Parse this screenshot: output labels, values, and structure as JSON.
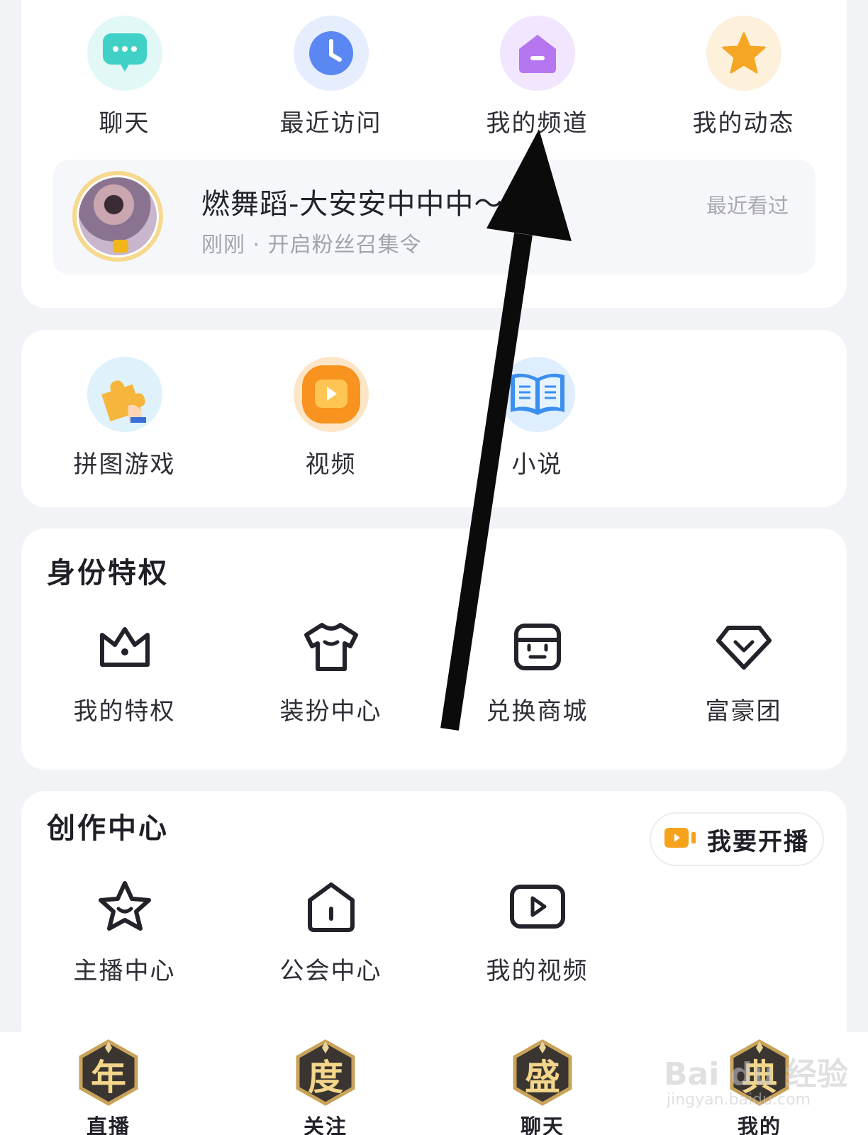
{
  "quick_actions": [
    {
      "label": "聊天",
      "icon": "chat-bubble-icon",
      "color": "#3fd1c6"
    },
    {
      "label": "最近访问",
      "icon": "clock-icon",
      "color": "#5b87f2"
    },
    {
      "label": "我的频道",
      "icon": "channel-house-icon",
      "color": "#b576f0"
    },
    {
      "label": "我的动态",
      "icon": "star-icon",
      "color": "#f5a623"
    }
  ],
  "recent": {
    "name": "燃舞蹈-大安安中中中～",
    "subtitle": "刚刚 · 开启粉丝召集令",
    "hint": "最近看过"
  },
  "apps": [
    {
      "label": "拼图游戏",
      "icon": "puzzle-icon"
    },
    {
      "label": "视频",
      "icon": "video-play-icon"
    },
    {
      "label": "小说",
      "icon": "book-icon"
    }
  ],
  "privilege": {
    "title": "身份特权",
    "items": [
      {
        "label": "我的特权",
        "icon": "crown-icon"
      },
      {
        "label": "装扮中心",
        "icon": "tshirt-icon"
      },
      {
        "label": "兑换商城",
        "icon": "store-icon"
      },
      {
        "label": "富豪团",
        "icon": "diamond-icon"
      }
    ]
  },
  "creator": {
    "title": "创作中心",
    "live_button": "我要开播",
    "items": [
      {
        "label": "主播中心",
        "icon": "star-smile-icon"
      },
      {
        "label": "公会中心",
        "icon": "guild-house-icon"
      },
      {
        "label": "我的视频",
        "icon": "video-frame-icon"
      }
    ]
  },
  "bottom_nav": [
    {
      "badge": "年",
      "label": "直播"
    },
    {
      "badge": "度",
      "label": "关注"
    },
    {
      "badge": "盛",
      "label": "聊天"
    },
    {
      "badge": "典",
      "label": "我的"
    }
  ],
  "watermark": {
    "main": "Bai du 经验",
    "sub": "jingyan.baidu.com"
  },
  "colors": {
    "background": "#f2f3f7",
    "card": "#ffffff",
    "accent_orange": "#f5a623",
    "text_primary": "#2e2e36",
    "text_secondary": "#a3a3ab"
  }
}
